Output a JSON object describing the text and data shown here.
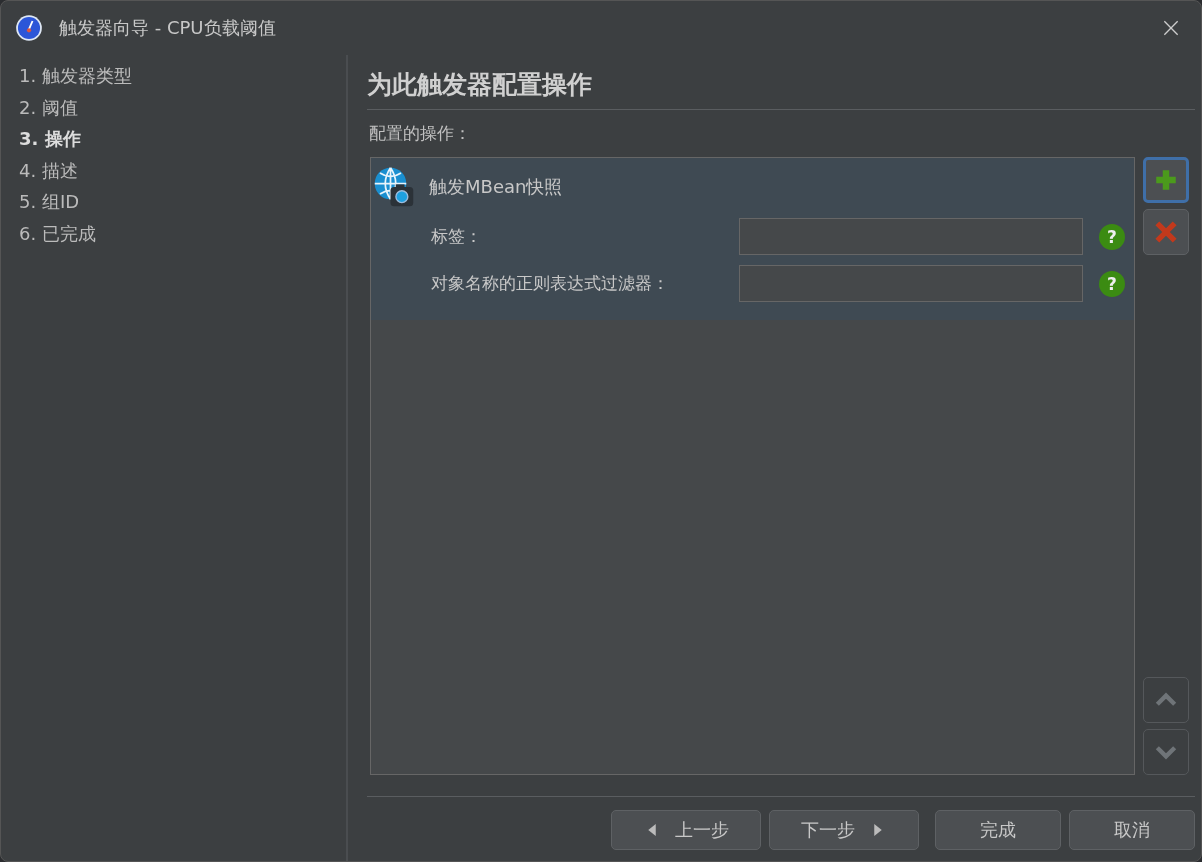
{
  "window": {
    "title": "触发器向导 - CPU负载阈值"
  },
  "steps": [
    {
      "label": "1. 触发器类型",
      "selected": false
    },
    {
      "label": "2. 阈值",
      "selected": false
    },
    {
      "label": "3. 操作",
      "selected": true
    },
    {
      "label": "4. 描述",
      "selected": false
    },
    {
      "label": "5. 组ID",
      "selected": false
    },
    {
      "label": "6. 已完成",
      "selected": false
    }
  ],
  "page": {
    "heading": "为此触发器配置操作",
    "list_label": "配置的操作："
  },
  "actions": [
    {
      "name": "触发MBean快照",
      "selected": true,
      "fields": [
        {
          "label": "标签：",
          "help": "?"
        },
        {
          "label": "对象名称的正则表达式过滤器：",
          "help": "?"
        }
      ]
    }
  ],
  "side_buttons": [
    {
      "kind": "add",
      "focused": true,
      "disabled": false
    },
    {
      "kind": "remove",
      "focused": false,
      "disabled": false
    },
    {
      "kind": "up",
      "focused": false,
      "disabled": true
    },
    {
      "kind": "down",
      "focused": false,
      "disabled": true
    }
  ],
  "footer_buttons": [
    {
      "kind": "back",
      "label": "上一步"
    },
    {
      "kind": "next",
      "label": "下一步"
    },
    {
      "kind": "finish",
      "label": "完成"
    },
    {
      "kind": "cancel",
      "label": "取消"
    }
  ]
}
